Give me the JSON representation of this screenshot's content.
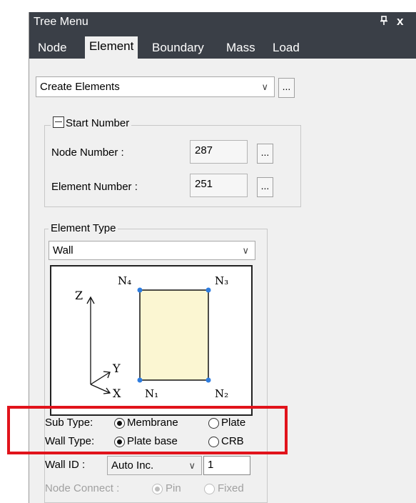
{
  "panel": {
    "title": "Tree Menu",
    "pin_glyph": "⩍",
    "close_glyph": "x"
  },
  "tabs": [
    {
      "label": "Node"
    },
    {
      "label": "Element"
    },
    {
      "label": "Boundary"
    },
    {
      "label": "Mass"
    },
    {
      "label": "Load"
    }
  ],
  "mode_select": {
    "value": "Create Elements",
    "more": "..."
  },
  "start_number": {
    "legend": "Start Number",
    "node_label": "Node Number    :",
    "node_value": "287",
    "element_label": "Element Number :",
    "element_value": "251",
    "more": "..."
  },
  "element_type": {
    "legend": "Element Type",
    "value": "Wall"
  },
  "diagram": {
    "n1": "N₁",
    "n2": "N₂",
    "n3": "N₃",
    "n4": "N₄",
    "axis_x": "X",
    "axis_y": "Y",
    "axis_z": "Z",
    "fill_color": "#fbf6d2",
    "node_color": "#2e7de0"
  },
  "sub_type": {
    "label": "Sub Type:",
    "opt1": "Membrane",
    "opt2": "Plate",
    "selected": "Membrane"
  },
  "wall_type": {
    "label": "Wall Type:",
    "opt1": "Plate base",
    "opt2": "CRB",
    "selected": "Plate base"
  },
  "wall_id": {
    "label": "Wall ID :",
    "mode": "Auto Inc.",
    "value": "1"
  },
  "node_connect": {
    "label": "Node Connect :",
    "opt1": "Pin",
    "opt2": "Fixed",
    "selected": "Pin"
  },
  "colors": {
    "titlebar": "#3a3f47",
    "highlight_box": "#e1131b"
  }
}
